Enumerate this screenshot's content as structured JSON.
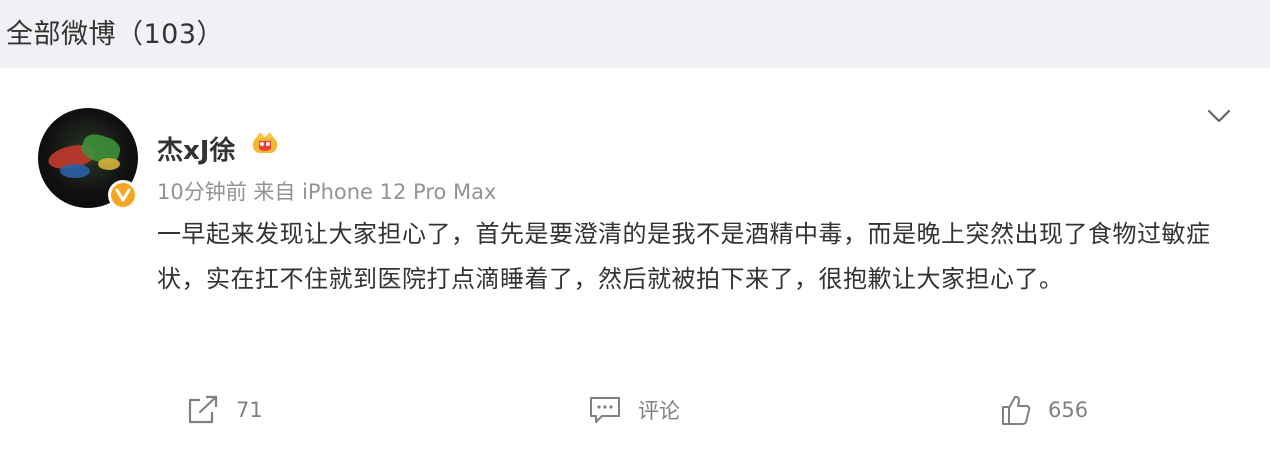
{
  "header": {
    "title": "全部微博（103）"
  },
  "post": {
    "username": "杰xJ徐",
    "meta": "10分钟前  来自 iPhone 12 Pro Max",
    "content": "一早起来发现让大家担心了，首先是要澄清的是我不是酒精中毒，而是晚上突然出现了食物过敏症状，实在扛不住就到医院打点滴睡着了，然后就被拍下来了，很抱歉让大家担心了。",
    "icons": {
      "avatar": "avatar",
      "verified": "verified-badge-icon",
      "member": "crown-icon",
      "more": "chevron-down-icon"
    }
  },
  "actions": {
    "repost_count": "71",
    "comment_label": "评论",
    "like_count": "656"
  },
  "colors": {
    "background": "#f0f1f4",
    "card": "#ffffff",
    "text": "#333333",
    "muted": "#939393",
    "verified": "#f5a623"
  }
}
